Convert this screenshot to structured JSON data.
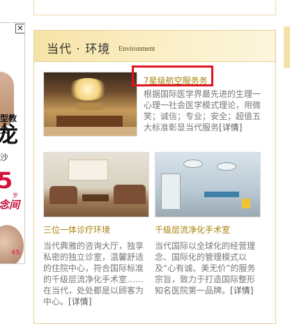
{
  "section": {
    "title": "当代 · 环境",
    "subtitle": "Environment"
  },
  "feature": {
    "title": "7星级航空服务务",
    "description": "根据国际医学界最先进的生理一心理一社会医学模式理论，用微笑；诚信；专业；安全；超值五大标准彰显当代服务",
    "more": "[详情]"
  },
  "items": [
    {
      "caption": "三位一体诊疗环境",
      "description": "当代典雅的咨询大厅，独享私密的独立诊室，温馨舒适的住院中心，符合国际标准的千级层流净化手术室……在当代，处处都是以顾客为中心。",
      "more": "[详情]"
    },
    {
      "caption": "千级层流净化手术室",
      "description": "当代国际以全球化的经营理念、国际化的管理模式以及“心有诚、美无价”的服务宗旨，致力于打造国际整形知名医院第一品牌。",
      "more": "[详情]"
    }
  ],
  "ad": {
    "close": "✕",
    "line1": "型教父",
    "line2": "龙",
    "line3": "沙",
    "line4": "5",
    "line5": "念间",
    "line6": "岁",
    "line7": "45"
  },
  "colors": {
    "accent_gold": "#a8820f",
    "highlight_red": "#e0141c",
    "header_bg": "#f6e3a6"
  }
}
